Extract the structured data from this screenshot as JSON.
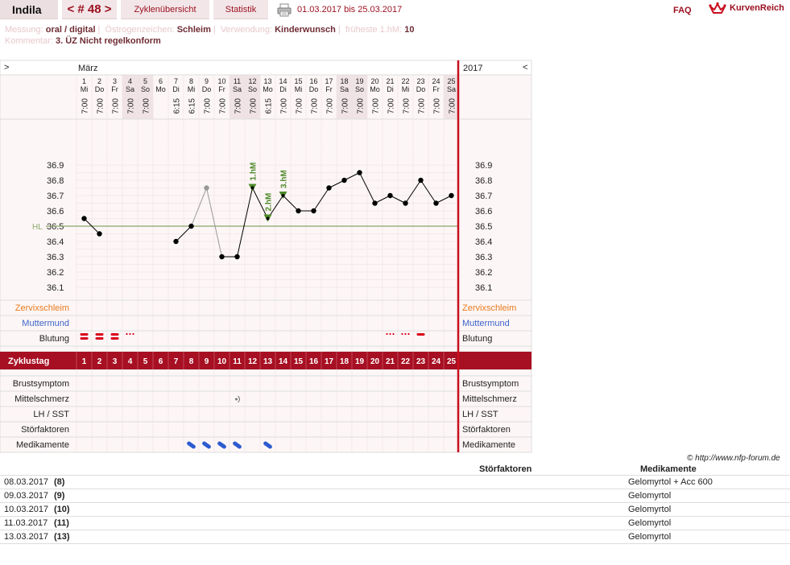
{
  "topbar": {
    "user": "Indila",
    "cycle": "< # 48 >",
    "overview": "Zyklenübersicht",
    "stats": "Statistik",
    "date_range": "01.03.2017 bis 25.03.2017",
    "faq": "FAQ",
    "logo": "KurvenReich"
  },
  "info": {
    "messung_label": "Messung:",
    "messung_value": "oral / digital",
    "oestrogen_label": "Östrogenzeichen:",
    "oestrogen_value": "Schleim",
    "verwendung_label": "Verwendung:",
    "verwendung_value": "Kinderwunsch",
    "fruehe_label": "früheste 1.hM:",
    "fruehe_value": "10",
    "kommentar_label": "Kommentar:",
    "kommentar_value": "3. ÜZ Nicht regelkonform"
  },
  "chart_data": {
    "type": "line",
    "nav_prev": ">",
    "nav_next": "<",
    "month": "März",
    "year": "2017",
    "days": [
      1,
      2,
      3,
      4,
      5,
      6,
      7,
      8,
      9,
      10,
      11,
      12,
      13,
      14,
      15,
      16,
      17,
      18,
      19,
      20,
      21,
      22,
      23,
      24,
      25
    ],
    "weekdays": [
      "Mi",
      "Do",
      "Fr",
      "Sa",
      "So",
      "Mo",
      "Di",
      "Mi",
      "Do",
      "Fr",
      "Sa",
      "So",
      "Mo",
      "Di",
      "Mi",
      "Do",
      "Fr",
      "Sa",
      "So",
      "Mo",
      "Di",
      "Mi",
      "Do",
      "Fr",
      "Sa"
    ],
    "weekend_days": [
      4,
      5,
      11,
      12,
      18,
      19,
      25
    ],
    "times": [
      "7:00",
      "7:00",
      "7:00",
      "7:00",
      "7:00",
      "",
      "6:15",
      "6:15",
      "7:00",
      "7:00",
      "7:00",
      "7:00",
      "6:15",
      "7:00",
      "7:00",
      "7:00",
      "7:00",
      "7:00",
      "7:00",
      "7:00",
      "7:00",
      "7:00",
      "7:00",
      "7:00",
      "7:00"
    ],
    "temperatures": [
      36.55,
      36.45,
      null,
      null,
      null,
      null,
      36.4,
      36.5,
      36.75,
      36.3,
      36.3,
      36.75,
      36.55,
      36.7,
      36.6,
      36.6,
      36.75,
      36.8,
      36.85,
      36.65,
      36.7,
      36.65,
      36.8,
      36.65,
      36.7
    ],
    "excluded_days": [
      9
    ],
    "ylim": [
      36.0,
      37.0
    ],
    "yticks": [
      "36.1",
      "36.2",
      "36.3",
      "36.4",
      "36.5",
      "36.6",
      "36.7",
      "36.8",
      "36.9"
    ],
    "coverline_label": "HL",
    "coverline_value": 36.5,
    "higher_measurements": [
      {
        "day": 12,
        "label": "1.hM"
      },
      {
        "day": 13,
        "label": "2.hM"
      },
      {
        "day": 14,
        "label": "3.hM"
      }
    ],
    "rows": {
      "cervix": "Zervixschleim",
      "mouth": "Muttermund",
      "bleeding": "Blutung",
      "cycle_day": "Zyklustag",
      "breast": "Brustsymptom",
      "mittelschmerz": "Mittelschmerz",
      "lh": "LH / SST",
      "stoer": "Störfaktoren",
      "meds": "Medikamente"
    },
    "bleeding_strong_days": [
      1,
      2,
      3
    ],
    "bleeding_spotting_days": [
      4,
      21,
      22
    ],
    "bleeding_light_days": [
      23
    ],
    "mittelschmerz_days": [
      11
    ],
    "medication_days": [
      8,
      9,
      10,
      11,
      13
    ],
    "colors": {
      "accent": "#9b0f1e",
      "cycle_row": "#a70f22",
      "coverline": "#8aa66a",
      "hm_marker": "#4e8a2a",
      "cervix_label": "#e87a1e",
      "mouth_label": "#3c64c8",
      "bleeding": "#d9001b",
      "medication": "#2d5bd0",
      "weekend": "#f0e3e5",
      "grid_bg": "#fdf6f6"
    }
  },
  "copyright": "© http://www.nfp-forum.de",
  "notes": {
    "col_stoer": "Störfaktoren",
    "col_meds": "Medikamente",
    "rows": [
      {
        "date": "08.03.2017",
        "day": "(8)",
        "med": "Gelomyrtol + Acc 600"
      },
      {
        "date": "09.03.2017",
        "day": "(9)",
        "med": "Gelomyrtol"
      },
      {
        "date": "10.03.2017",
        "day": "(10)",
        "med": "Gelomyrtol"
      },
      {
        "date": "11.03.2017",
        "day": "(11)",
        "med": "Gelomyrtol"
      },
      {
        "date": "13.03.2017",
        "day": "(13)",
        "med": "Gelomyrtol"
      }
    ]
  }
}
